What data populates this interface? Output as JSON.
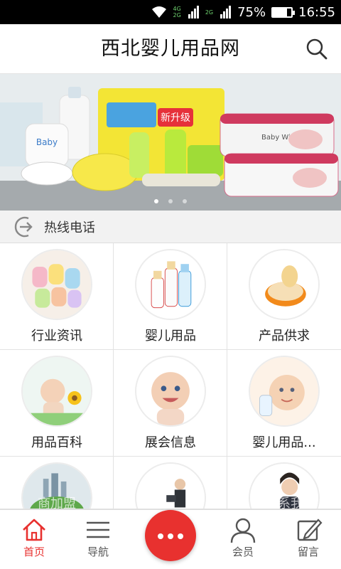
{
  "status_bar": {
    "network_top": "4G",
    "network_bottom": "2G",
    "network_top_2": "2G",
    "battery_percent": "75%",
    "battery_level": 0.75,
    "time": "16:55"
  },
  "header": {
    "title": "西北婴儿用品网",
    "search_icon": "search-icon"
  },
  "banner": {
    "slide_count": 3,
    "active_slide": 0,
    "product_text_1": "Baby",
    "product_text_2": "新升级",
    "product_text_3": "Baby Wipes"
  },
  "hotline": {
    "icon": "phone-arrow-icon",
    "label": "热线电话"
  },
  "grid": {
    "items": [
      {
        "label": "行业资讯"
      },
      {
        "label": "婴儿用品"
      },
      {
        "label": "产品供求"
      },
      {
        "label": "用品百科"
      },
      {
        "label": "展会信息"
      },
      {
        "label": "婴儿用品..."
      },
      {
        "label": "商加盟"
      },
      {
        "label": ""
      },
      {
        "label": "联系我"
      }
    ]
  },
  "bottom_nav": {
    "home": "首页",
    "nav": "导航",
    "member": "会员",
    "message": "留言",
    "accent_color": "#e8312f"
  }
}
